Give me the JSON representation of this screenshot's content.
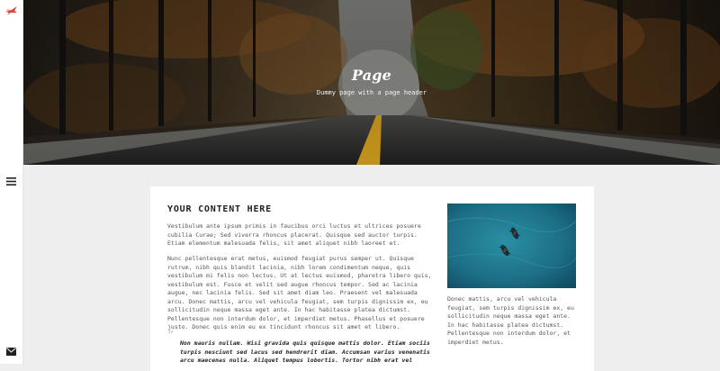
{
  "hero": {
    "title": "Page",
    "subtitle": "Dummy page with a page header"
  },
  "content": {
    "heading": "YOUR CONTENT HERE",
    "paragraph1": "Vestibulum ante ipsum primis in faucibus orci luctus et ultrices posuere cubilia Curae; Sed viverra rhoncus placerat. Quisque sed auctor turpis. Etiam elementum malesuada felis, sit amet aliquet nibh laoreet et.",
    "paragraph2": "Nunc pellentesque erat metus, euismod feugiat purus semper ut. Quisque rutrum, nibh quis blandit lacinia, nibh lorem condimentum neque, quis vestibulum mi felis non lectus. Ut at lectus euismod, pharetra libero quis, vestibulum est. Fusce et velit sed augue rhoncus tempor. Sed ac lacinia augue, nec lacinia felis. Sed sit amet diam leo. Praesent vel malesuada arcu. Donec mattis, arcu vel vehicula feugiat, sem turpis dignissim ex, eu sollicitudin neque massa eget ante. In hac habitasse platea dictumst. Pellentesque non interdum dolor, et imperdiet metus. Phasellus et posuere justo. Donec quis enim eu ex tincidunt rhoncus sit amet et libero.",
    "quote": "Non mauris nullam. Wisi gravida quis quisque mattis dolor. Etiam sociis turpis nesciunt sed lacus sed hendrerit diam. Accumsan varius venenatis arcu maecenas nulla. Aliquet tempus lobortis. Tortor nibh erat vel",
    "side_caption": "Donec mattis, arcu vel vehicula feugiat, sem turpis dignissim ex, eu sollicitudin neque massa eget ante. In hac habitasse platea dictumst. Pellentesque non interdum dolor, et imperdiet metus."
  },
  "icons": {
    "logo": "bird-logo-icon",
    "menu": "hamburger-menu-icon",
    "mail": "envelope-icon"
  },
  "colors": {
    "accent": "#e0413a",
    "page_bg": "#eeeeee",
    "card_bg": "#ffffff"
  }
}
